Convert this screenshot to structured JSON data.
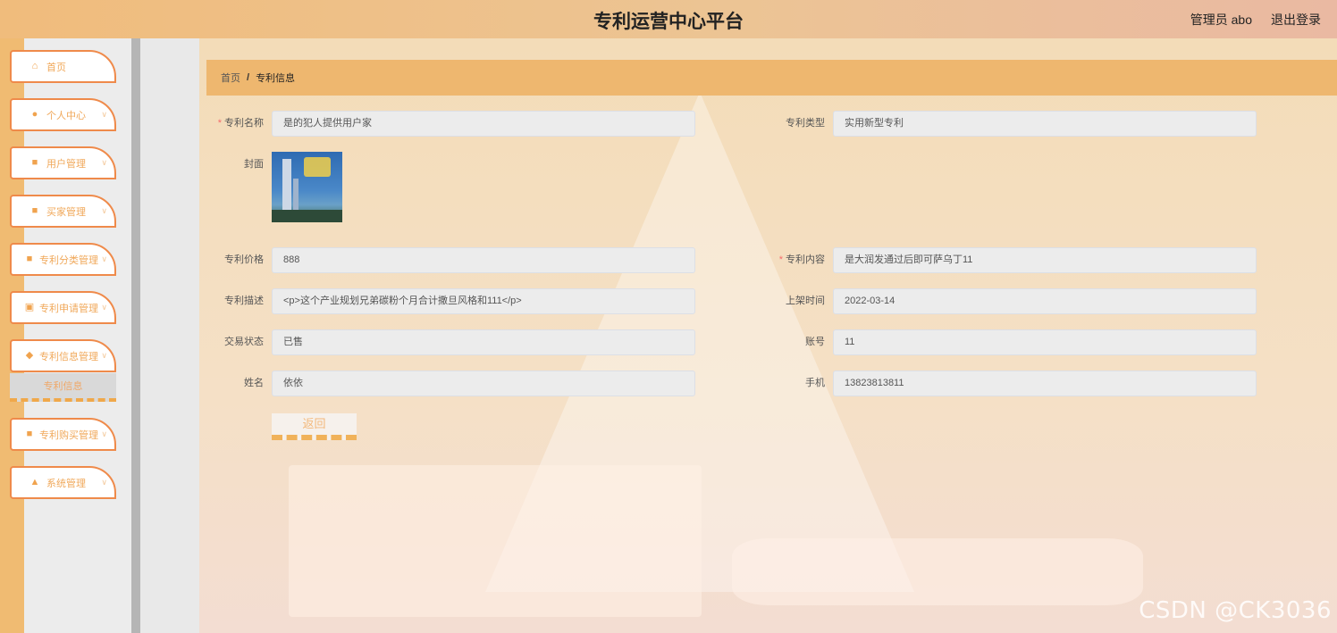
{
  "header": {
    "title": "专利运营中心平台",
    "user": "管理员 abo",
    "logout": "退出登录"
  },
  "menu": {
    "items": [
      {
        "label": "首页",
        "icon": "home-icon",
        "glyph": "⌂",
        "arrow": ""
      },
      {
        "label": "个人中心",
        "icon": "user-icon",
        "glyph": "●",
        "arrow": "∨"
      },
      {
        "label": "用户管理",
        "icon": "grid-icon",
        "glyph": "■",
        "arrow": "∨"
      },
      {
        "label": "买家管理",
        "icon": "grid-icon",
        "glyph": "■",
        "arrow": "∨"
      },
      {
        "label": "专利分类管理",
        "icon": "grid-icon",
        "glyph": "■",
        "arrow": "∨"
      },
      {
        "label": "专利申请管理",
        "icon": "check-icon",
        "glyph": "▣",
        "arrow": "∨"
      },
      {
        "label": "专利信息管理",
        "icon": "thumb-icon",
        "glyph": "◆",
        "arrow": "∨"
      },
      {
        "label": "专利购买管理",
        "icon": "grid-icon",
        "glyph": "■",
        "arrow": "∨"
      },
      {
        "label": "系统管理",
        "icon": "person-icon",
        "glyph": "▲",
        "arrow": "∨"
      }
    ],
    "sub_item": "专利信息"
  },
  "breadcrumb": {
    "home": "首页",
    "sep": "/",
    "current": "专利信息"
  },
  "form": {
    "name": {
      "label": "专利名称",
      "value": "是的犯人提供用户家"
    },
    "type": {
      "label": "专利类型",
      "value": "实用新型专利"
    },
    "cover": {
      "label": "封面"
    },
    "price": {
      "label": "专利价格",
      "value": "888"
    },
    "content": {
      "label": "专利内容",
      "value": "是大润发通过后即可萨乌丁11"
    },
    "desc": {
      "label": "专利描述",
      "value": "<p>这个产业规划兄弟碳粉个月合计撒旦风格和111</p>"
    },
    "shelf_time": {
      "label": "上架时间",
      "value": "2022-03-14"
    },
    "status": {
      "label": "交易状态",
      "value": "已售"
    },
    "account": {
      "label": "账号",
      "value": "11"
    },
    "realname": {
      "label": "姓名",
      "value": "依依"
    },
    "phone": {
      "label": "手机",
      "value": "13823813811"
    },
    "required_mark": "*",
    "back_label": "返回"
  },
  "watermark": "CSDN @CK3036"
}
